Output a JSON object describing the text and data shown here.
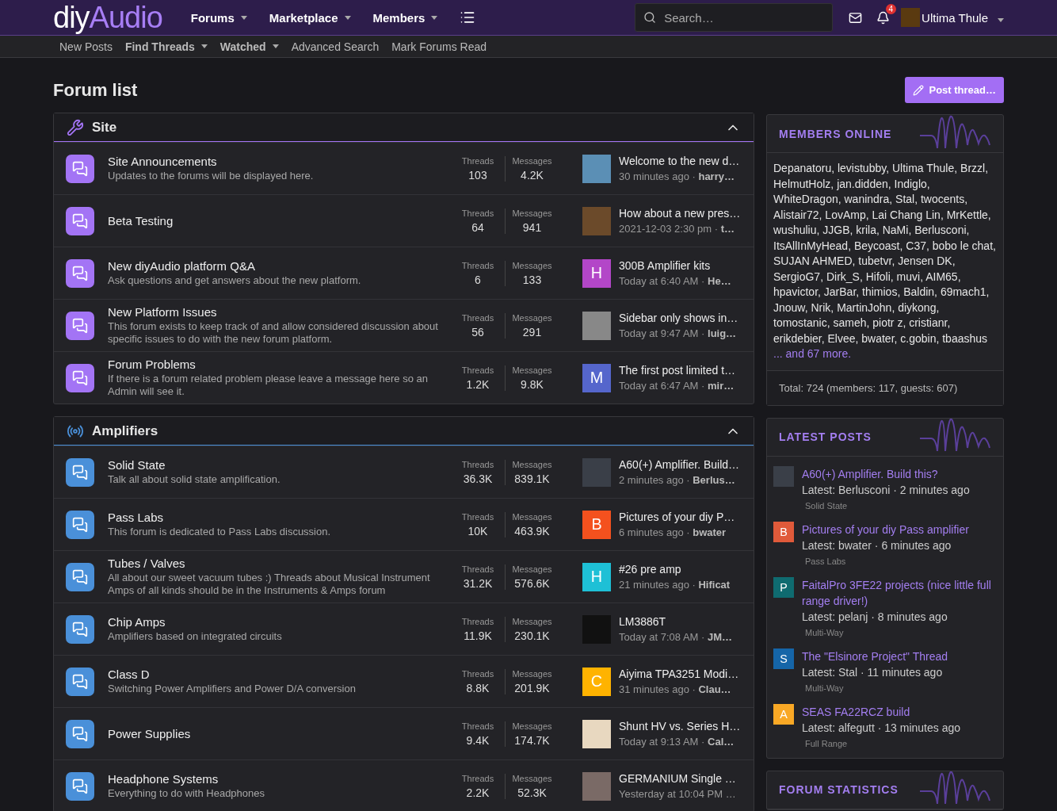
{
  "header": {
    "logo": {
      "part1": "diy",
      "part2": "Audio"
    },
    "nav": [
      {
        "label": "Forums",
        "has_menu": true
      },
      {
        "label": "Marketplace",
        "has_menu": true
      },
      {
        "label": "Members",
        "has_menu": true
      }
    ],
    "search": {
      "placeholder": "Search…"
    },
    "notification_count": "4",
    "user": {
      "name": "Ultima Thule"
    }
  },
  "subnav": [
    {
      "label": "New Posts",
      "has_menu": false
    },
    {
      "label": "Find Threads",
      "has_menu": true
    },
    {
      "label": "Watched",
      "has_menu": true
    },
    {
      "label": "Advanced Search",
      "has_menu": false
    },
    {
      "label": "Mark Forums Read",
      "has_menu": false
    }
  ],
  "page_title": "Forum list",
  "post_button": "Post thread…",
  "categories": [
    {
      "title": "Site",
      "color": "#a374f5",
      "expanded": true,
      "forums": [
        {
          "name": "Site Announcements",
          "description": "Updates to the forums will be displayed here.",
          "threads_label": "Threads",
          "threads": "103",
          "messages_label": "Messages",
          "messages": "4.2K",
          "last": {
            "avatar": {
              "kind": "photo",
              "color": "#5b8fb5"
            },
            "title": "Welcome to the new d…",
            "meta": "30 minutes ago · **harry…**"
          }
        },
        {
          "name": "Beta Testing",
          "threads_label": "Threads",
          "threads": "64",
          "messages_label": "Messages",
          "messages": "941",
          "last": {
            "avatar": {
              "kind": "photo",
              "color": "#6b4a2a"
            },
            "title": "How about a new pres…",
            "meta": "2021-12-03 2:30 pm · **t…**"
          }
        },
        {
          "name": "New diyAudio platform Q&A",
          "description": "Ask questions and get answers about the new platform.",
          "threads_label": "Threads",
          "threads": "6",
          "messages_label": "Messages",
          "messages": "133",
          "last": {
            "avatar": {
              "kind": "letter",
              "letter": "H",
              "color": "#b346c8"
            },
            "title": "300B Amplifier kits",
            "meta": "Today at 6:40 AM · **He…**"
          }
        },
        {
          "name": "New Platform Issues",
          "description": "This forum exists to keep track of and allow considered discussion about specific issues to do with the new forum platform.",
          "threads_label": "Threads",
          "threads": "56",
          "messages_label": "Messages",
          "messages": "291",
          "last": {
            "avatar": {
              "kind": "photo",
              "color": "#888888"
            },
            "title": "Sidebar only shows in…",
            "meta": "Today at 9:47 AM · **luig…**"
          }
        },
        {
          "name": "Forum Problems",
          "description": "If there is a forum related problem please leave a message here so an Admin will see it.",
          "threads_label": "Threads",
          "threads": "1.2K",
          "messages_label": "Messages",
          "messages": "9.8K",
          "last": {
            "avatar": {
              "kind": "letter",
              "letter": "M",
              "color": "#5566cc"
            },
            "title": "The first post limited t…",
            "meta": "Today at 6:47 AM · **mir…**"
          }
        }
      ]
    },
    {
      "title": "Amplifiers",
      "color": "#4a90d9",
      "expanded": true,
      "forums": [
        {
          "name": "Solid State",
          "description": "Talk all about solid state amplification.",
          "threads_label": "Threads",
          "threads": "36.3K",
          "messages_label": "Messages",
          "messages": "839.1K",
          "last": {
            "avatar": {
              "kind": "photo",
              "color": "#3a3f48"
            },
            "title": "A60(+) Amplifier. Build…",
            "meta": "2 minutes ago · **Berlus…**"
          }
        },
        {
          "name": "Pass Labs",
          "description": "This forum is dedicated to Pass Labs discussion.",
          "threads_label": "Threads",
          "threads": "10K",
          "messages_label": "Messages",
          "messages": "463.9K",
          "last": {
            "avatar": {
              "kind": "letter",
              "letter": "B",
              "color": "#f4511e"
            },
            "title": "Pictures of your diy P…",
            "meta": "6 minutes ago · **bwater**"
          }
        },
        {
          "name": "Tubes / Valves",
          "description": "All about our sweet vacuum tubes :) Threads about Musical Instrument Amps of all kinds should be in the Instruments & Amps forum",
          "threads_label": "Threads",
          "threads": "31.2K",
          "messages_label": "Messages",
          "messages": "576.6K",
          "last": {
            "avatar": {
              "kind": "letter",
              "letter": "H",
              "color": "#1ec0d6"
            },
            "title": "#26 pre amp",
            "meta": "21 minutes ago · **Hificat**"
          }
        },
        {
          "name": "Chip Amps",
          "description": "Amplifiers based on integrated circuits",
          "threads_label": "Threads",
          "threads": "11.9K",
          "messages_label": "Messages",
          "messages": "230.1K",
          "last": {
            "avatar": {
              "kind": "photo",
              "color": "#111111"
            },
            "title": "LM3886T",
            "meta": "Today at 7:08 AM · **JM…**"
          }
        },
        {
          "name": "Class D",
          "description": "Switching Power Amplifiers and Power D/A conversion",
          "threads_label": "Threads",
          "threads": "8.8K",
          "messages_label": "Messages",
          "messages": "201.9K",
          "last": {
            "avatar": {
              "kind": "letter",
              "letter": "C",
              "color": "#ffb300"
            },
            "title": "Aiyima TPA3251 Modi…",
            "meta": "31 minutes ago · **Clau…**"
          }
        },
        {
          "name": "Power Supplies",
          "threads_label": "Threads",
          "threads": "9.4K",
          "messages_label": "Messages",
          "messages": "174.7K",
          "last": {
            "avatar": {
              "kind": "photo",
              "color": "#e8d8c0"
            },
            "title": "Shunt HV vs. Series H…",
            "meta": "Today at 9:13 AM · **Cal…**"
          }
        },
        {
          "name": "Headphone Systems",
          "description": "Everything to do with Headphones",
          "threads_label": "Threads",
          "threads": "2.2K",
          "messages_label": "Messages",
          "messages": "52.3K",
          "last": {
            "avatar": {
              "kind": "photo",
              "color": "#7a6a66"
            },
            "title": "GERMANIUM Single …",
            "meta": "Yesterday at 10:04 PM …"
          }
        }
      ]
    }
  ],
  "members_online": {
    "title": "MEMBERS ONLINE",
    "names": "Depanatoru, levistubby, Ultima Thule, Brzzl, HelmutHolz, jan.didden, Indiglo, WhiteDragon, wanindra, Stal, twocents, Alistair72, LovAmp, Lai Chang Lin, MrKettle, wushuliu, JJGB, krila, NaMi, Berlusconi, ItsAllInMyHead, Beycoast, C37, bobo le chat, SUJAN AHMED, tubetvr, Jensen DK, SergioG7, Dirk_S, Hifoli, muvi, AIM65, hpavictor, JarBar, thimios, Baldin, 69mach1, Jnouw, Nrik, MartinJohn, diykong, tomostanic, sameh, piotr z, cristianr, erikdebier, Elvee, bwater, c.gobin, tbaashus",
    "more": "... and 67 more.",
    "total": "Total: 724 (members: 117, guests: 607)"
  },
  "latest_posts": {
    "title": "LATEST POSTS",
    "items": [
      {
        "avatar": {
          "kind": "photo",
          "color": "#3a3f48"
        },
        "title": "A60(+) Amplifier. Build this?",
        "meta": "Latest: Berlusconi · 2 minutes ago",
        "forum": "Solid State"
      },
      {
        "avatar": {
          "kind": "letter",
          "letter": "B",
          "color": "#e05a3a"
        },
        "title": "Pictures of your diy Pass amplifier",
        "meta": "Latest: bwater · 6 minutes ago",
        "forum": "Pass Labs"
      },
      {
        "avatar": {
          "kind": "letter",
          "letter": "P",
          "color": "#0f6b70"
        },
        "title": "FaitalPro 3FE22 projects (nice little full range driver!)",
        "meta": "Latest: pelanj · 8 minutes ago",
        "forum": "Multi-Way"
      },
      {
        "avatar": {
          "kind": "letter",
          "letter": "S",
          "color": "#1565a8"
        },
        "title": "The \"Elsinore Project\" Thread",
        "meta": "Latest: Stal · 11 minutes ago",
        "forum": "Multi-Way"
      },
      {
        "avatar": {
          "kind": "letter",
          "letter": "A",
          "color": "#f9a825"
        },
        "title": "SEAS FA22RCZ build",
        "meta": "Latest: alfegutt · 13 minutes ago",
        "forum": "Full Range"
      }
    ]
  },
  "forum_statistics": {
    "title": "FORUM STATISTICS"
  }
}
